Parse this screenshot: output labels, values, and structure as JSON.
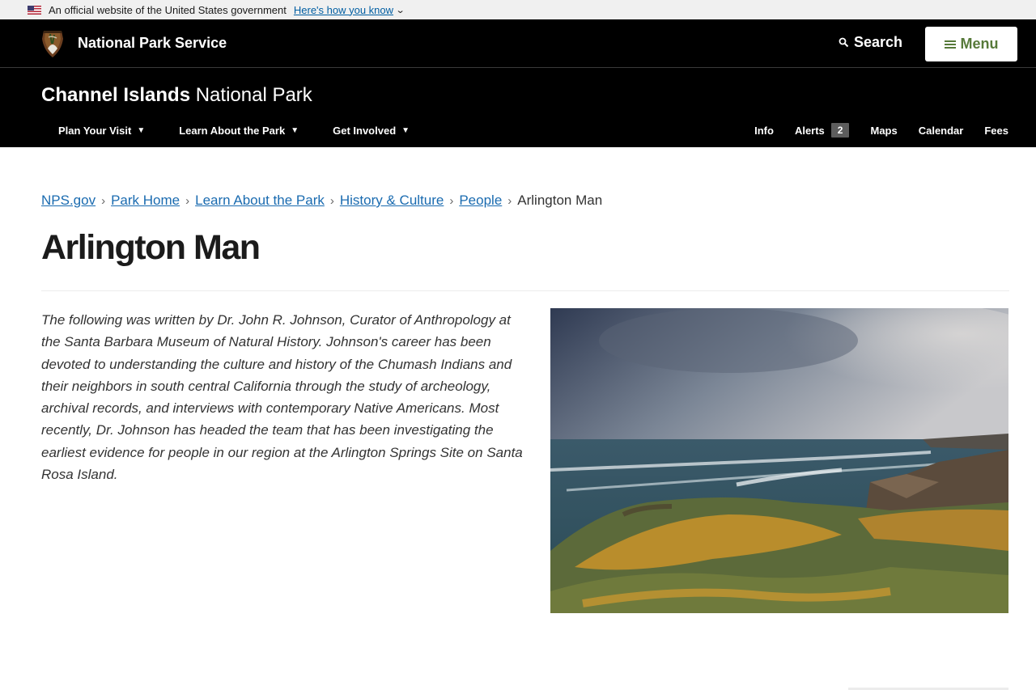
{
  "gov_banner": {
    "text": "An official website of the United States government",
    "link": "Here's how you know",
    "chevron": "⌄"
  },
  "header": {
    "site_title": "National Park Service",
    "search_label": "Search",
    "menu_label": "Menu",
    "icons": {
      "logo": "arrowhead-logo-icon",
      "search": "search-icon",
      "menu": "hamburger-icon"
    }
  },
  "park": {
    "name_bold": "Channel Islands",
    "name_light": "National Park",
    "nav_left": [
      {
        "label": "Plan Your Visit",
        "caret": "▼"
      },
      {
        "label": "Learn About the Park",
        "caret": "▼"
      },
      {
        "label": "Get Involved",
        "caret": "▼"
      }
    ],
    "nav_right": {
      "info": "Info",
      "alerts": "Alerts",
      "alerts_count": "2",
      "maps": "Maps",
      "calendar": "Calendar",
      "fees": "Fees"
    }
  },
  "breadcrumb": {
    "items": [
      "NPS.gov",
      "Park Home",
      "Learn About the Park",
      "History & Culture",
      "People"
    ],
    "separator": "›",
    "current": "Arlington Man"
  },
  "page": {
    "title": "Arlington Man",
    "intro": "The following was written by Dr. John R. Johnson, Curator of Anthropology at the Santa Barbara Museum of Natural History. Johnson's career has been devoted to understanding the culture and history of the Chumash Indians and their neighbors in south central California through the study of archeology, archival records, and interviews with contemporary Native Americans. Most recently, Dr. Johnson has headed the team that has been investigating the earliest evidence for people in our region at the Arlington Springs Site on Santa Rosa Island."
  },
  "colors": {
    "header_bg": "#000000",
    "link": "#1a6bb0",
    "menu_accent": "#577a3a",
    "alert_badge": "#5d5d5d"
  }
}
